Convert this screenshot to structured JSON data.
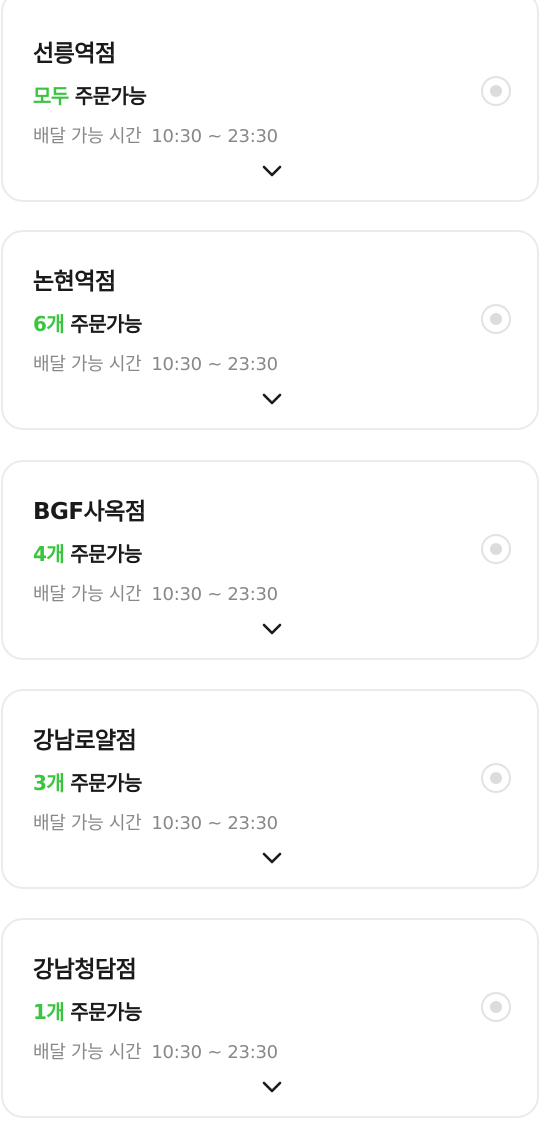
{
  "stores": [
    {
      "name": "선릉역점",
      "count": "모두",
      "order_label": "주문가능",
      "hours_label": "배달 가능 시간",
      "hours": "10:30 ~ 23:30"
    },
    {
      "name": "논현역점",
      "count": "6개",
      "order_label": "주문가능",
      "hours_label": "배달 가능 시간",
      "hours": "10:30 ~ 23:30"
    },
    {
      "name": "BGF사옥점",
      "count": "4개",
      "order_label": "주문가능",
      "hours_label": "배달 가능 시간",
      "hours": "10:30 ~ 23:30"
    },
    {
      "name": "강남로얄점",
      "count": "3개",
      "order_label": "주문가능",
      "hours_label": "배달 가능 시간",
      "hours": "10:30 ~ 23:30"
    },
    {
      "name": "강남청담점",
      "count": "1개",
      "order_label": "주문가능",
      "hours_label": "배달 가능 시간",
      "hours": "10:30 ~ 23:30"
    }
  ],
  "icons": {
    "radio": "radio-button-icon",
    "expand": "chevron-down-icon"
  },
  "colors": {
    "accent": "#3ac43f",
    "text": "#1a1a1a",
    "muted": "#888888",
    "border": "#ebebeb"
  }
}
